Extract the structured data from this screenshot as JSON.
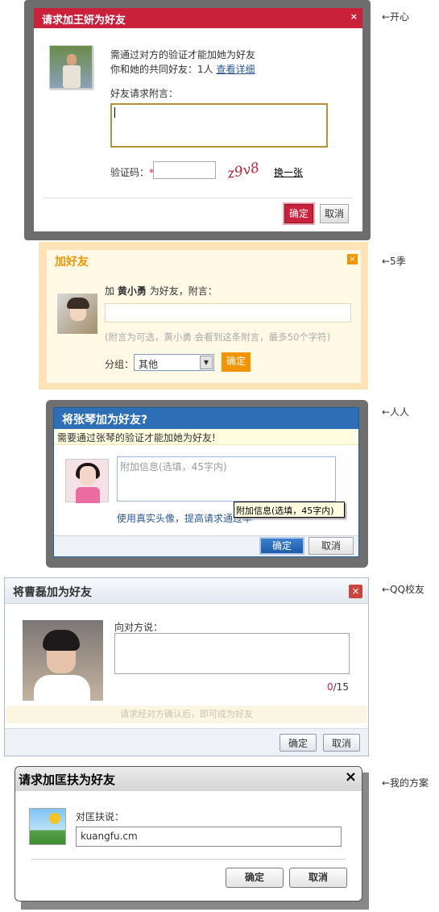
{
  "labels": {
    "kaixin": "←开心",
    "q5": "←5季",
    "renren": "←人人",
    "qq": "←QQ校友",
    "mine": "←我的方案"
  },
  "d1": {
    "title": "请求加王妍为好友",
    "close": "×",
    "line1": "需通过对方的验证才能加她为好友",
    "line2_prefix": "你和她的共同好友：1人",
    "line2_link": "查看详细",
    "message_label": "好友请求附言：",
    "captcha_label": "验证码：",
    "captcha_star": "*",
    "captcha_text": "z9v8",
    "refresh_link": "换一张",
    "confirm": "确定",
    "cancel": "取消",
    "accent": "#c9203b"
  },
  "d2": {
    "title": "加好友",
    "close": "×",
    "line1_prefix": "加",
    "line1_name": "黄小勇",
    "line1_suffix": "为好友，附言：",
    "hint": "(附言为可选，黄小勇 会看到这条附言，最多50个字符)",
    "group_label": "分组：",
    "group_value": "其他",
    "confirm": "确定",
    "accent": "#f29400"
  },
  "d3": {
    "title": "将张琴加为好友?",
    "notice": "需要通过张琴的验证才能加她为好友!",
    "placeholder": "附加信息(选填，45字内)",
    "link": "使用真实头像，提高请求通过率",
    "confirm": "确定",
    "cancel": "取消",
    "tooltip": "附加信息(选填，45字内)",
    "accent": "#2e6eb6"
  },
  "d4": {
    "title": "将曹磊加为好友",
    "close": "×",
    "say_label": "向对方说：",
    "count_current": "0",
    "count_max": "/15",
    "hint": "请求经对方确认后，即可成为好友",
    "confirm": "确定",
    "cancel": "取消"
  },
  "d5": {
    "title": "请求加匡扶为好友",
    "close": "×",
    "say_label": "对匡扶说：",
    "input_value": "kuangfu.cm",
    "confirm": "确定",
    "cancel": "取消"
  }
}
